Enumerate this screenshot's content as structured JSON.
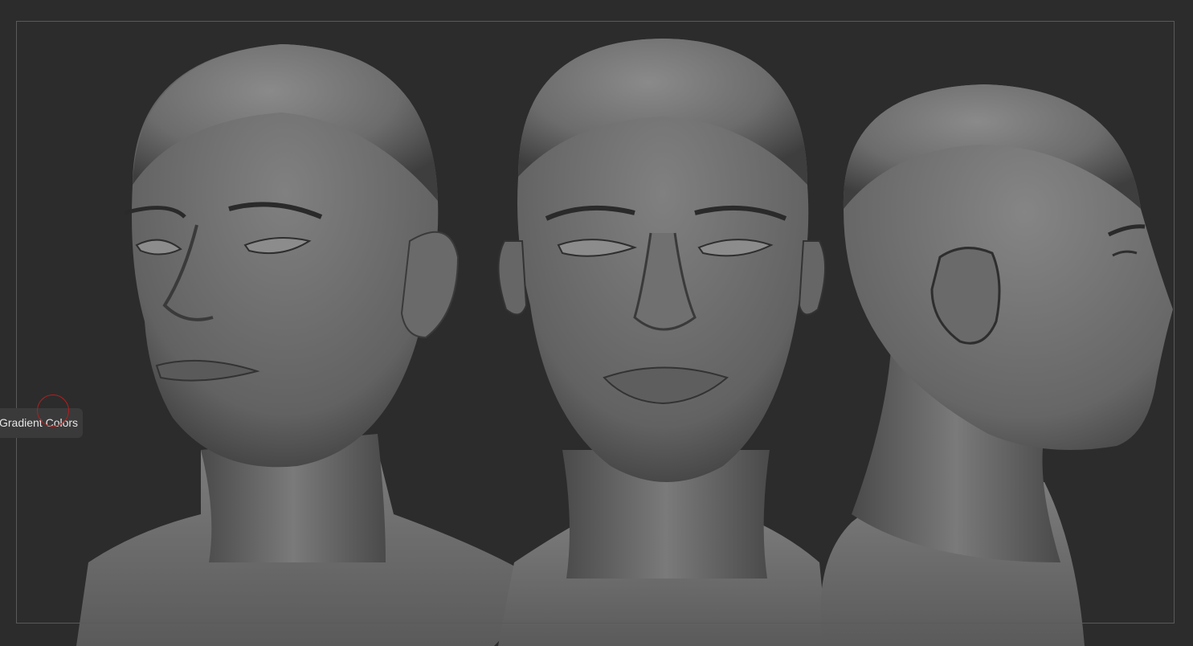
{
  "viewport": {
    "background": "#2c2c2c",
    "frame_color": "#5a5a5a"
  },
  "tooltip": {
    "text": "Gradient Colors"
  },
  "cursor": {
    "ring_color": "#b51e1e",
    "icon": "brush-cursor-icon"
  },
  "models": [
    {
      "view": "three-quarter"
    },
    {
      "view": "front"
    },
    {
      "view": "side"
    }
  ]
}
